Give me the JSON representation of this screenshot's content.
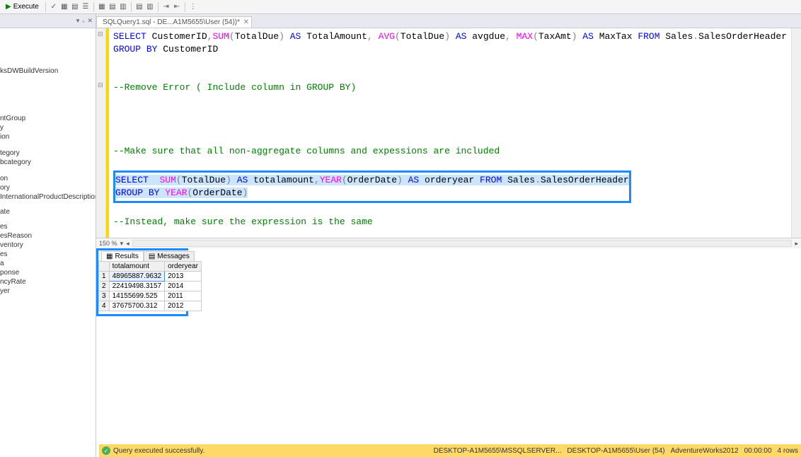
{
  "toolbar": {
    "execute_label": "Execute"
  },
  "tab": {
    "title": "SQLQuery1.sql - DE...A1M5655\\User (54))*"
  },
  "sidebar": {
    "items": [
      "ksDWBuildVersion",
      "",
      "",
      "ntGroup",
      "y",
      "ion",
      "tegory",
      "bcategory",
      "",
      "on",
      "ory",
      "InternationalProductDescription",
      "",
      "ate",
      "",
      "es",
      "esReason",
      "ventory",
      "es",
      "a",
      "ponse",
      "ncyRate",
      "yer"
    ]
  },
  "code": {
    "line1_select": "SELECT",
    "line1_rest1": " CustomerID",
    "line1_comma1": ",",
    "line1_sum": "SUM",
    "line1_p1": "(",
    "line1_td1": "TotalDue",
    "line1_p2": ")",
    "line1_as1": " AS",
    "line1_ta": " TotalAmount",
    "line1_comma2": ", ",
    "line1_avg": "AVG",
    "line1_p3": "(",
    "line1_td2": "TotalDue",
    "line1_p4": ")",
    "line1_as2": " AS",
    "line1_ad": " avgdue",
    "line1_comma3": ", ",
    "line1_max": "MAX",
    "line1_p5": "(",
    "line1_tx": "TaxAmt",
    "line1_p6": ")",
    "line1_as3": " AS",
    "line1_mt": " MaxTax ",
    "line1_from": "FROM",
    "line1_tbl": " Sales",
    "line1_dot": ".",
    "line1_soh": "SalesOrderHeader",
    "line2_group": "GROUP",
    "line2_by": " BY",
    "line2_cid": " CustomerID",
    "comment1": "--Remove Error ( Include column in GROUP BY)",
    "comment2": "--Make sure that all non-aggregate columns and expessions are included",
    "hl_select": "SELECT",
    "hl_sp1": "  ",
    "hl_sum": "SUM",
    "hl_p1": "(",
    "hl_td": "TotalDue",
    "hl_p2": ")",
    "hl_as1": " AS",
    "hl_ta": " totalamount",
    "hl_c1": ",",
    "hl_year1": "YEAR",
    "hl_p3": "(",
    "hl_od1": "OrderDate",
    "hl_p4": ")",
    "hl_as2": " AS",
    "hl_oy": " orderyear ",
    "hl_from": "FROM",
    "hl_tbl": " Sales",
    "hl_dot": ".",
    "hl_soh": "SalesOrderHeader",
    "hl2_group": "GROUP",
    "hl2_by": " BY",
    "hl2_sp": " ",
    "hl2_year": "YEAR",
    "hl2_p1": "(",
    "hl2_od": "OrderDate",
    "hl2_p2": ")",
    "comment3": "--Instead, make sure the expression is the same"
  },
  "zoom": "150 %",
  "results": {
    "tabs": {
      "results": "Results",
      "messages": "Messages"
    },
    "columns": [
      "totalamount",
      "orderyear"
    ],
    "rows": [
      {
        "n": "1",
        "totalamount": "48965887.9632",
        "orderyear": "2013"
      },
      {
        "n": "2",
        "totalamount": "22419498.3157",
        "orderyear": "2014"
      },
      {
        "n": "3",
        "totalamount": "14155699.525",
        "orderyear": "2011"
      },
      {
        "n": "4",
        "totalamount": "37675700.312",
        "orderyear": "2012"
      }
    ]
  },
  "status": {
    "message": "Query executed successfully.",
    "server": "DESKTOP-A1M5655\\MSSQLSERVER...",
    "user": "DESKTOP-A1M5655\\User (54)",
    "db": "AdventureWorks2012",
    "time": "00:00:00",
    "rows": "4 rows"
  }
}
